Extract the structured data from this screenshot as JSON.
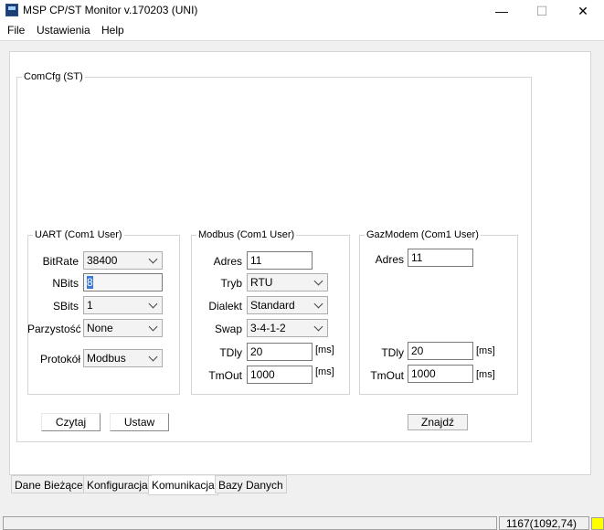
{
  "window": {
    "title": "MSP CP/ST Monitor v.170203 (UNI)",
    "minimize_glyph": "—",
    "maximize_glyph": "☐",
    "close_glyph": "✕"
  },
  "menu": [
    "File",
    "Ustawienia",
    "Help"
  ],
  "comcfg": {
    "title": "ComCfg (ST)",
    "uart": {
      "title": "UART (Com1 User)",
      "bitrate_label": "BitRate",
      "bitrate": "38400",
      "nbits_label": "NBits",
      "nbits": "8",
      "sbits_label": "SBits",
      "sbits": "1",
      "parity_label": "Parzystość",
      "parity": "None",
      "protocol_label": "Protokół",
      "protocol": "Modbus"
    },
    "modbus": {
      "title": "Modbus (Com1 User)",
      "adres_label": "Adres",
      "adres": "11",
      "tryb_label": "Tryb",
      "tryb": "RTU",
      "dialekt_label": "Dialekt",
      "dialekt": "Standard",
      "swap_label": "Swap",
      "swap": "3-4-1-2",
      "tdly_label": "TDly",
      "tdly": "20",
      "tdly_unit": "[ms]",
      "tmout_label": "TmOut",
      "tmout": "1000",
      "tmout_unit": "[ms]"
    },
    "gazmodem": {
      "title": "GazModem (Com1 User)",
      "adres_label": "Adres",
      "adres": "11",
      "tdly_label": "TDly",
      "tdly": "20",
      "tdly_unit": "[ms]",
      "tmout_label": "TmOut",
      "tmout": "1000",
      "tmout_unit": "[ms]"
    },
    "buttons": {
      "read": "Czytaj",
      "set": "Ustaw",
      "find": "Znajdź"
    }
  },
  "tabs": [
    {
      "label": "Dane Bieżące",
      "active": false
    },
    {
      "label": "Konfiguracja",
      "active": false
    },
    {
      "label": "Komunikacja",
      "active": true
    },
    {
      "label": "Bazy Danych",
      "active": false
    }
  ],
  "status": {
    "text": "1167(1092,74)",
    "indicator_color": "#ffff00"
  }
}
